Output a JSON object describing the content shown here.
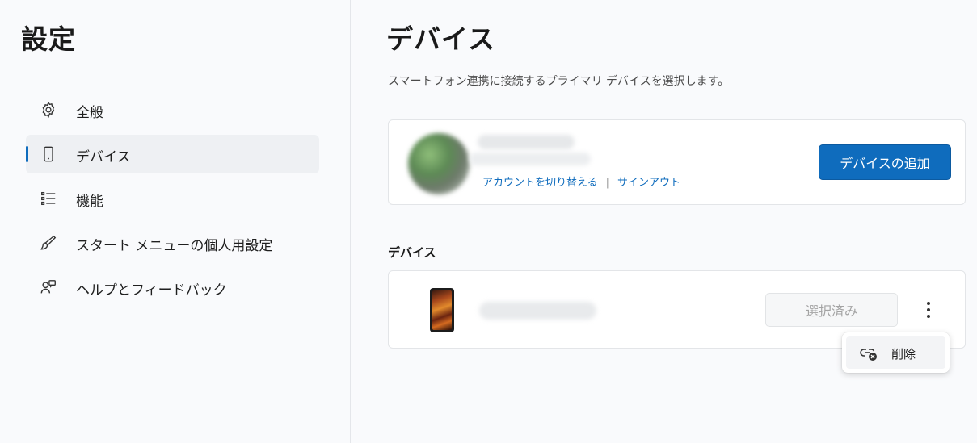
{
  "sidebar": {
    "title": "設定",
    "items": [
      {
        "label": "全般",
        "icon": "gear-icon",
        "selected": false
      },
      {
        "label": "デバイス",
        "icon": "phone-icon",
        "selected": true
      },
      {
        "label": "機能",
        "icon": "list-icon",
        "selected": false
      },
      {
        "label": "スタート メニューの個人用設定",
        "icon": "brush-icon",
        "selected": false
      },
      {
        "label": "ヘルプとフィードバック",
        "icon": "help-icon",
        "selected": false
      }
    ]
  },
  "main": {
    "title": "デバイス",
    "subtitle": "スマートフォン連携に接続するプライマリ デバイスを選択します。",
    "account": {
      "switch_link": "アカウントを切り替える",
      "separator": "|",
      "signout_link": "サインアウト",
      "add_device_label": "デバイスの追加"
    },
    "devices_section": {
      "title": "デバイス",
      "selected_label": "選択済み"
    },
    "context_menu": {
      "delete_label": "削除"
    }
  },
  "colors": {
    "accent": "#0f6cbd",
    "sidebar_bg": "#f9fafc",
    "card_bg": "#ffffff"
  }
}
